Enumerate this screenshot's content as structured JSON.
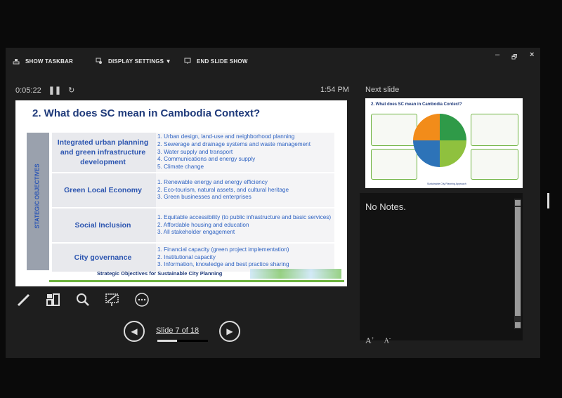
{
  "toolbar": {
    "show_taskbar": "SHOW TASKBAR",
    "display_settings": "DISPLAY SETTINGS ▼",
    "end_slide_show": "END SLIDE SHOW"
  },
  "window_controls": {
    "minimize": "–",
    "restore": "🗗",
    "close": "×"
  },
  "timer": {
    "elapsed": "0:05:22",
    "clock": "1:54 PM"
  },
  "slide": {
    "title": "2. What does SC mean in Cambodia Context?",
    "side_label": "STATEGIC OBJECTIVES",
    "rows": [
      {
        "name": "Integrated urban planning and green infrastructure development",
        "items": [
          "1. Urban design, land-use and neighborhood planning",
          "2. Sewerage and drainage systems and waste management",
          "3. Water supply and transport",
          "4. Communications and energy supply",
          "5. Climate change"
        ]
      },
      {
        "name": "Green Local Economy",
        "items": [
          "1. Renewable energy and energy efficiency",
          "2. Eco-tourism, natural assets, and cultural heritage",
          "3. Green businesses and enterprises"
        ]
      },
      {
        "name": "Social Inclusion",
        "items": [
          "1. Equitable accessibility (to public infrastructure and basic services)",
          "2. Affordable housing and education",
          "3. All stakeholder engagement"
        ]
      },
      {
        "name": "City governance",
        "items": [
          "1. Financial capacity (green project implementation)",
          "2. Institutional capacity",
          "3. Information, knowledge and best practice sharing"
        ]
      }
    ],
    "footer": "Strategic Objectives for Sustainable City Planning"
  },
  "navigation": {
    "slide_counter": "Slide 7 of 18",
    "progress_fraction": 0.39
  },
  "next_slide": {
    "label": "Next slide",
    "title": "2. What does SC mean in Cambodia Context?",
    "footer": "Sustainable City Planning Approach"
  },
  "notes": {
    "text": "No Notes."
  },
  "font_buttons": {
    "increase": "A",
    "decrease": "A"
  }
}
